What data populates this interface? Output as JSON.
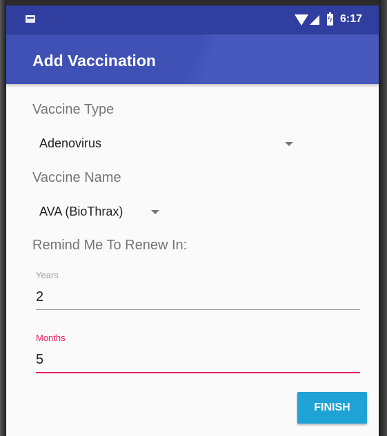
{
  "status_bar": {
    "time": "6:17",
    "icons": [
      "notification-icon",
      "wifi-icon",
      "signal-icon",
      "battery-charging-icon"
    ]
  },
  "app_bar": {
    "title": "Add Vaccination",
    "color": "#3f51b5"
  },
  "form": {
    "vaccine_type_label": "Vaccine Type",
    "vaccine_type_value": "Adenovirus",
    "vaccine_name_label": "Vaccine Name",
    "vaccine_name_value": "AVA (BioThrax)",
    "remind_label": "Remind Me To Renew In:",
    "years": {
      "label": "Years",
      "value": "2"
    },
    "months": {
      "label": "Months",
      "value": "5",
      "accent": "#e91e63"
    }
  },
  "actions": {
    "finish_label": "FINISH",
    "finish_color": "#1fa2d6"
  }
}
